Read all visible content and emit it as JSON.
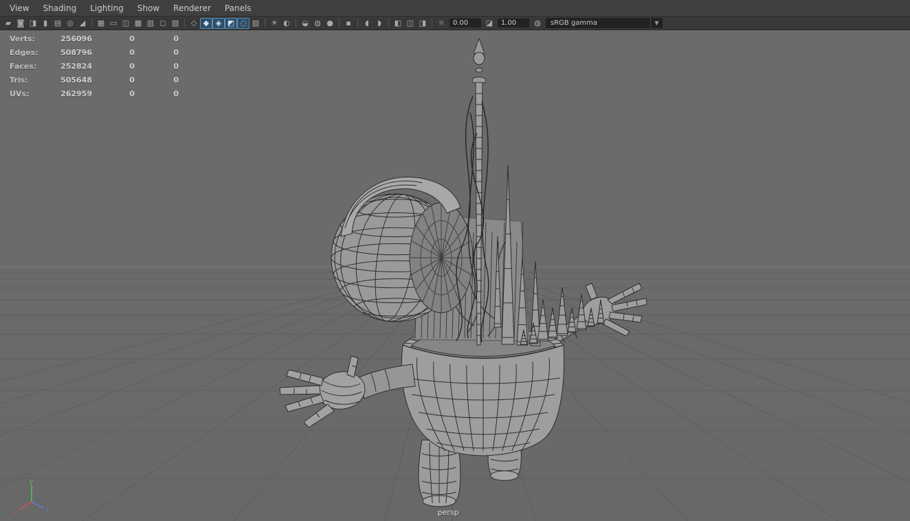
{
  "menu_bar": {
    "items": [
      "View",
      "Shading",
      "Lighting",
      "Show",
      "Renderer",
      "Panels"
    ]
  },
  "toolbar": {
    "groups": [
      {
        "name": "camera-tools",
        "icons": [
          {
            "name": "select-camera-icon",
            "glyph": "▰"
          },
          {
            "name": "lock-camera-icon",
            "glyph": "◙"
          },
          {
            "name": "camera-attributes-icon",
            "glyph": "◨"
          },
          {
            "name": "bookmarks-icon",
            "glyph": "▮"
          },
          {
            "name": "image-plane-icon",
            "glyph": "▤"
          },
          {
            "name": "pan-zoom-icon",
            "glyph": "◎"
          },
          {
            "name": "grease-pencil-icon",
            "glyph": "◢"
          }
        ]
      },
      {
        "name": "display-gates",
        "icons": [
          {
            "name": "grid-icon",
            "glyph": "▦"
          },
          {
            "name": "film-gate-icon",
            "glyph": "▭"
          },
          {
            "name": "resolution-gate-icon",
            "glyph": "◫"
          },
          {
            "name": "gate-mask-icon",
            "glyph": "▩"
          },
          {
            "name": "field-chart-icon",
            "glyph": "▥"
          },
          {
            "name": "safe-action-icon",
            "glyph": "◻"
          },
          {
            "name": "safe-title-icon",
            "glyph": "▧"
          }
        ]
      },
      {
        "name": "shading-modes",
        "icons": [
          {
            "name": "wireframe-icon",
            "glyph": "◇"
          },
          {
            "name": "smooth-shade-icon",
            "glyph": "◆",
            "active": true
          },
          {
            "name": "wireframe-on-shaded-icon",
            "glyph": "◈",
            "active": true
          },
          {
            "name": "textured-icon",
            "glyph": "◩",
            "active": true
          },
          {
            "name": "use-default-material-icon",
            "glyph": "◌",
            "active": true
          },
          {
            "name": "checker-material-icon",
            "glyph": "▨"
          }
        ]
      },
      {
        "name": "lighting",
        "icons": [
          {
            "name": "use-all-lights-icon",
            "glyph": "☀"
          },
          {
            "name": "shadows-icon",
            "glyph": "◐"
          }
        ]
      },
      {
        "name": "render-effects",
        "icons": [
          {
            "name": "occlusion-icon",
            "glyph": "◒"
          },
          {
            "name": "motion-blur-icon",
            "glyph": "◍"
          },
          {
            "name": "multisample-icon",
            "glyph": "●"
          }
        ]
      },
      {
        "name": "fog",
        "icons": [
          {
            "name": "fog-icon",
            "glyph": "▪"
          }
        ]
      },
      {
        "name": "xray",
        "icons": [
          {
            "name": "xray-icon",
            "glyph": "◖"
          },
          {
            "name": "xray-joints-icon",
            "glyph": "◗"
          }
        ]
      },
      {
        "name": "isolate",
        "icons": [
          {
            "name": "isolate-select-icon",
            "glyph": "◧"
          },
          {
            "name": "plane-mode-icon",
            "glyph": "◫"
          },
          {
            "name": "selection-highlight-icon",
            "glyph": "◨"
          }
        ]
      }
    ],
    "exposure": {
      "icon_glyph": "☼",
      "value": "0.00"
    },
    "gamma": {
      "icon_glyph": "◪",
      "value": "1.00"
    },
    "view_transform": {
      "icon_glyph": "◍",
      "value": "sRGB gamma",
      "arrow_glyph": "▼"
    }
  },
  "hud": {
    "rows": [
      {
        "label": "Verts:",
        "values": [
          "256096",
          "0",
          "0"
        ]
      },
      {
        "label": "Edges:",
        "values": [
          "508796",
          "0",
          "0"
        ]
      },
      {
        "label": "Faces:",
        "values": [
          "252824",
          "0",
          "0"
        ]
      },
      {
        "label": "Tris:",
        "values": [
          "505648",
          "0",
          "0"
        ]
      },
      {
        "label": "UVs:",
        "values": [
          "262959",
          "0",
          "0"
        ]
      }
    ]
  },
  "viewport": {
    "camera_label": "persp",
    "axis": {
      "x_label": "x",
      "y_label": "y",
      "z_label": "z",
      "x_color": "#d65151",
      "y_color": "#54c454",
      "z_color": "#5f7fd6"
    },
    "background_color": "#6b6b6b",
    "wireframe_color": "#2d2d2d",
    "active_icon_highlight": "#2e4d66"
  }
}
